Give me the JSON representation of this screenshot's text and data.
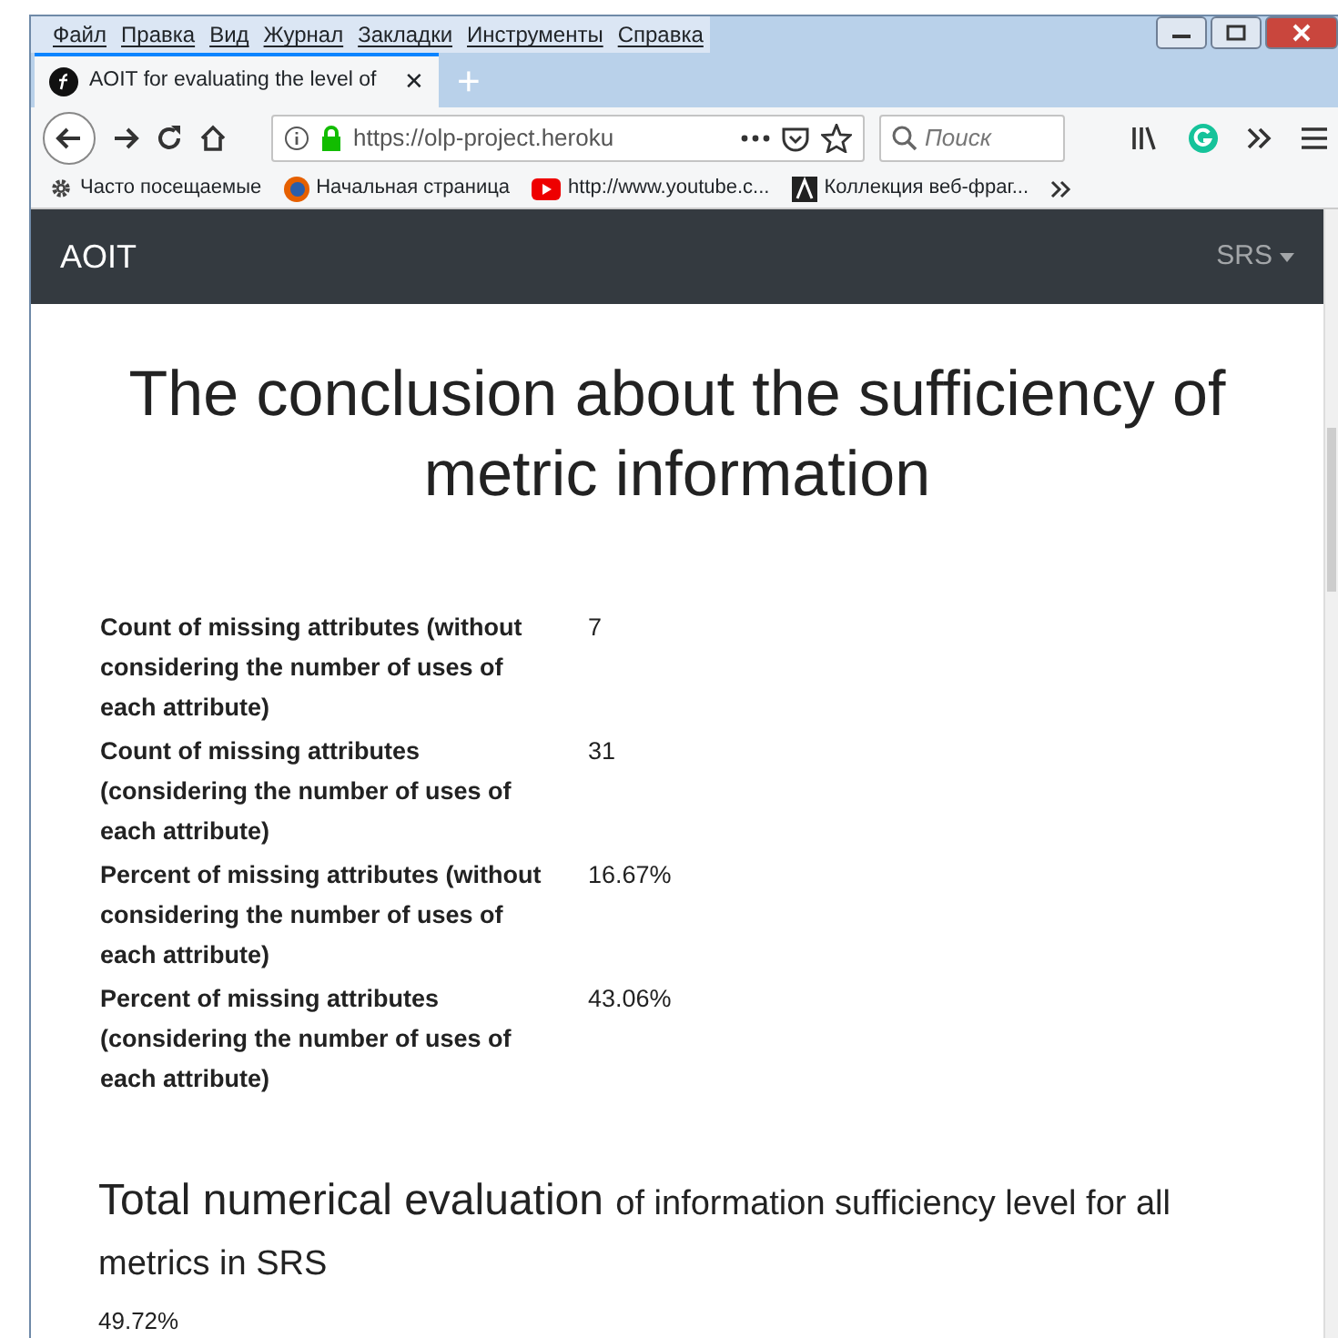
{
  "menu_bar": [
    "Файл",
    "Правка",
    "Вид",
    "Журнал",
    "Закладки",
    "Инструменты",
    "Справка"
  ],
  "tabs": [
    {
      "title": "AOIT for evaluating the level of",
      "selected": true,
      "close": "✕"
    }
  ],
  "new_tab": "+",
  "url": "https://olp-project.heroku",
  "search": {
    "placeholder": "Поиск"
  },
  "bookmarks": [
    {
      "kind": "gear",
      "label": "Часто посещаемые"
    },
    {
      "kind": "firefox",
      "label": "Начальная страница"
    },
    {
      "kind": "youtube",
      "label": "http://www.youtube.c..."
    },
    {
      "kind": "slice",
      "label": "Коллекция веб-фраг..."
    }
  ],
  "navbar": {
    "brand": "AOIT",
    "menu": "SRS"
  },
  "title": "The conclusion about the sufficiency of metric information",
  "metrics": [
    {
      "label": "Count of missing attributes (without considering the number of uses of each attribute)",
      "value": "7"
    },
    {
      "label": "Count of missing attributes (considering the number of uses of each attribute)",
      "value": "31"
    },
    {
      "label": "Percent of missing attributes (without considering the number of uses of each attribute)",
      "value": "16.67%"
    },
    {
      "label": "Percent of missing attributes (considering the number of uses of each attribute)",
      "value": "43.06%"
    }
  ],
  "total": {
    "heading": "Total numerical evaluation",
    "subheading": "of information sufficiency level for all metrics in SRS",
    "value": "49.72%"
  }
}
